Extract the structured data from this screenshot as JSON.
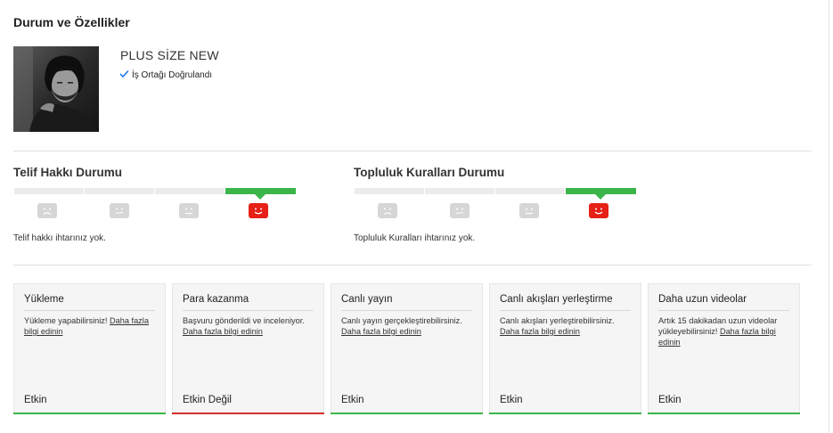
{
  "header": {
    "title": "Durum ve Özellikler"
  },
  "channel": {
    "name": "PLUS SİZE NEW",
    "verified_label": "İş Ortağı Doğrulandı"
  },
  "copyright": {
    "title": "Telif Hakkı Durumu",
    "status_text": "Telif hakkı ihtarınız yok.",
    "strikes": 0
  },
  "community": {
    "title": "Topluluk Kuralları Durumu",
    "status_text": "Topluluk Kuralları ihtarınız yok.",
    "strikes": 0
  },
  "features": [
    {
      "title": "Yükleme",
      "desc": "Yükleme yapabilirsiniz! ",
      "link": "Daha fazla bilgi edinin",
      "status": "Etkin",
      "enabled": true
    },
    {
      "title": "Para kazanma",
      "desc": "Başvuru gönderildi ve inceleniyor. ",
      "link": "Daha fazla bilgi edinin",
      "status": "Etkin Değil",
      "enabled": false
    },
    {
      "title": "Canlı yayın",
      "desc": "Canlı yayın gerçekleştirebilirsiniz. ",
      "link": "Daha fazla bilgi edinin",
      "status": "Etkin",
      "enabled": true
    },
    {
      "title": "Canlı akışları yerleştirme",
      "desc": "Canlı akışları yerleştirebilirsiniz. ",
      "link": "Daha fazla bilgi edinin",
      "status": "Etkin",
      "enabled": true
    },
    {
      "title": "Daha uzun videolar",
      "desc": "Artık 15 dakikadan uzun videolar yükleyebilirsiniz! ",
      "link": "Daha fazla bilgi edinin",
      "status": "Etkin",
      "enabled": true
    }
  ],
  "colors": {
    "enabled": "#3bb54a",
    "disabled": "#d2302a",
    "good_face": "#e62117",
    "neutral_face": "#d6d6d6"
  },
  "icons": {
    "verified": "check-icon",
    "strike_faces": [
      "sad-face-icon",
      "confused-face-icon",
      "neutral-face-icon",
      "happy-face-icon"
    ]
  }
}
